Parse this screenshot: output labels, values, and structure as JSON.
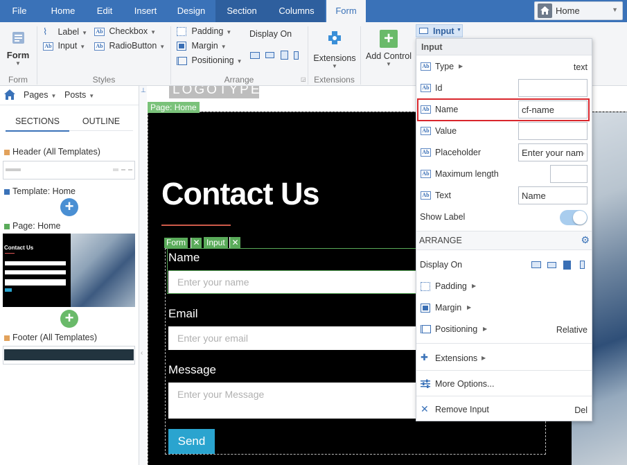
{
  "tabs": [
    "File",
    "Home",
    "Edit",
    "Insert",
    "Design",
    "Section",
    "Columns",
    "Form"
  ],
  "page_select": {
    "value": "Home"
  },
  "ribbon": {
    "form": {
      "label": "Form",
      "group": "Form"
    },
    "styles": {
      "label": "Label",
      "input": "Input",
      "checkbox": "Checkbox",
      "radiobutton": "RadioButton",
      "group": "Styles"
    },
    "arrange": {
      "padding": "Padding",
      "margin": "Margin",
      "positioning": "Positioning",
      "display_on": "Display On",
      "group": "Arrange"
    },
    "extensions": {
      "label": "Extensions",
      "group": "Extensions"
    },
    "add_control": {
      "label": "Add Control"
    },
    "input_menu": {
      "label": "Input"
    }
  },
  "left_panel": {
    "pages": "Pages",
    "posts": "Posts",
    "tab_sections": "SECTIONS",
    "tab_outline": "OUTLINE",
    "header": "Header (All Templates)",
    "template": "Template: Home",
    "page": "Page: Home",
    "footer": "Footer (All Templates)",
    "thumb_title": "Contact Us"
  },
  "canvas": {
    "logotype": "LOGOTYPE",
    "page_tag": "Page: Home",
    "heading": "Contact Us",
    "form_tag": "Form",
    "input_tag": "Input",
    "name_label": "Name",
    "name_placeholder": "Enter your name",
    "email_label": "Email",
    "email_placeholder": "Enter your email",
    "message_label": "Message",
    "message_placeholder": "Enter your Message",
    "send": "Send"
  },
  "popup": {
    "title": "Input",
    "type_label": "Type",
    "type_value": "text",
    "id_label": "Id",
    "id_value": "",
    "name_label": "Name",
    "name_value": "cf-name",
    "value_label": "Value",
    "value_value": "",
    "placeholder_label": "Placeholder",
    "placeholder_value": "Enter your name",
    "maxlen_label": "Maximum length",
    "maxlen_value": "",
    "text_label": "Text",
    "text_value": "Name",
    "show_label": "Show Label",
    "arrange": "ARRANGE",
    "display_on": "Display On",
    "padding": "Padding",
    "margin": "Margin",
    "positioning": "Positioning",
    "positioning_value": "Relative",
    "extensions": "Extensions",
    "more_options": "More Options...",
    "remove_input": "Remove Input",
    "remove_shortcut": "Del"
  },
  "colors": {
    "accent": "#3a72b8",
    "green": "#6aba6a",
    "send": "#2aa4cf",
    "highlight": "#d9262c"
  }
}
